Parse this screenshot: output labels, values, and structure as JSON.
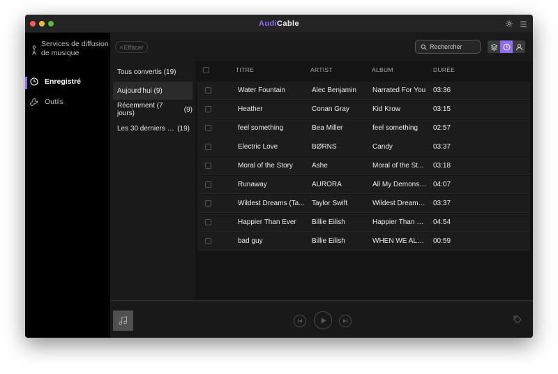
{
  "app": {
    "title_prefix": "Audi",
    "title_suffix": "Cable",
    "accent_color": "#8f6cf0"
  },
  "sidebar": {
    "items": [
      {
        "label": "Services de diffusion de musique",
        "icon": "mic-icon"
      },
      {
        "label": "Enregistré",
        "icon": "clock-icon",
        "active": true
      },
      {
        "label": "Outils",
        "icon": "wrench-icon"
      }
    ]
  },
  "toolbar": {
    "clear_label": "Effacer",
    "clear_glyph": "×",
    "search_placeholder": "Rechercher"
  },
  "filters": [
    {
      "label": "Tous convertis",
      "count": "(19)"
    },
    {
      "label": "Aujourd'hui",
      "count": "(9)",
      "active": true
    },
    {
      "label": "Récemment (7 jours)",
      "count": "(9)"
    },
    {
      "label": "Les 30 derniers jo...",
      "count": "(19)"
    }
  ],
  "table": {
    "columns": [
      "TITRE",
      "ARTIST",
      "ALBUM",
      "DURÉE"
    ],
    "rows": [
      {
        "title": "Water Fountain",
        "artist": "Alec Benjamin",
        "album": "Narrated For You",
        "duration": "03:36"
      },
      {
        "title": "Heather",
        "artist": "Conan Gray",
        "album": "Kid Krow",
        "duration": "03:15"
      },
      {
        "title": "feel something",
        "artist": "Bea Miller",
        "album": "feel something",
        "duration": "02:57"
      },
      {
        "title": "Electric Love",
        "artist": "BØRNS",
        "album": "Candy",
        "duration": "03:37"
      },
      {
        "title": "Moral of the Story",
        "artist": "Ashe",
        "album": "Moral of the St...",
        "duration": "03:18"
      },
      {
        "title": "Runaway",
        "artist": "AURORA",
        "album": "All My Demons ...",
        "duration": "04:07"
      },
      {
        "title": "Wildest Dreams (Ta...",
        "artist": "Taylor Swift",
        "album": "Wildest Dreams...",
        "duration": "03:37"
      },
      {
        "title": "Happier Than Ever",
        "artist": "Billie Eilish",
        "album": "Happier Than E...",
        "duration": "04:54"
      },
      {
        "title": "bad guy",
        "artist": "Billie Eilish",
        "album": "WHEN WE ALL F...",
        "duration": "00:59"
      }
    ]
  }
}
